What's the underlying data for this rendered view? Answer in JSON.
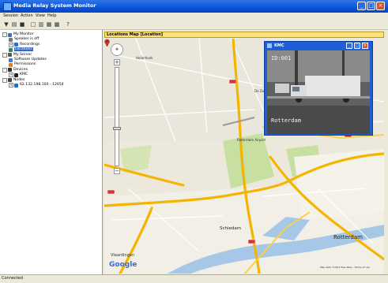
{
  "window": {
    "title": "Media Relay System Monitor"
  },
  "menu": [
    "Session",
    "Action",
    "View",
    "Help"
  ],
  "toolbar": [
    {
      "name": "filter-icon",
      "glyph": "▼"
    },
    {
      "name": "open-folder-icon",
      "glyph": "▤"
    },
    {
      "name": "save-icon",
      "glyph": "■"
    },
    {
      "name": "layout-single-icon",
      "glyph": "□"
    },
    {
      "name": "layout-split-icon",
      "glyph": "▥"
    },
    {
      "name": "layout-grid-icon",
      "glyph": "▦"
    },
    {
      "name": "layout-multi-icon",
      "glyph": "▩"
    },
    {
      "name": "help-icon",
      "glyph": "?"
    }
  ],
  "tree": [
    {
      "label": "My Monitor",
      "icon": "monitor-icon",
      "color": "#4a6fa5",
      "level": 0,
      "exp": "-"
    },
    {
      "label": "Speaker is off",
      "icon": "speaker-icon",
      "color": "#777777",
      "level": 1
    },
    {
      "label": "Recordings",
      "icon": "recordings-icon",
      "color": "#2f6fd0",
      "level": 1,
      "exp": "+"
    },
    {
      "label": "Locations",
      "icon": "globe-icon",
      "color": "#2e8b57",
      "level": 1,
      "selected": true
    },
    {
      "label": "My Server",
      "icon": "server-icon",
      "color": "#5a5a5a",
      "level": 0,
      "exp": "-"
    },
    {
      "label": "Software Updates",
      "icon": "updates-icon",
      "color": "#3a7bd5",
      "level": 1
    },
    {
      "label": "Permissions",
      "icon": "permissions-icon",
      "color": "#d9822b",
      "level": 1
    },
    {
      "label": "Devices",
      "icon": "devices-icon",
      "color": "#333333",
      "level": 0,
      "exp": "-"
    },
    {
      "label": "KMC",
      "icon": "camera-icon",
      "color": "#222222",
      "level": 1,
      "exp": "+"
    },
    {
      "label": "Nodes",
      "icon": "nodes-icon",
      "color": "#444444",
      "level": 0,
      "exp": "-"
    },
    {
      "label": "62.132.198.100 - 12654",
      "icon": "node-icon",
      "color": "#2b6cb0",
      "level": 1,
      "exp": "+"
    }
  ],
  "panel": {
    "header": "Locations Map [Location]"
  },
  "map": {
    "labels": [
      "Rotterdam",
      "Schiedam",
      "Vlaardingen",
      "De Zweth",
      "Rotterdam Airport"
    ],
    "google_logo": "Google",
    "copyright": "Map data ©2010 Tele Atlas - Terms of Use"
  },
  "camera": {
    "title": "KMC",
    "overlay_id": "ID:001",
    "overlay_location": "Rotterdam"
  },
  "status": {
    "text": "Connected"
  },
  "colors": {
    "titlebar": "#0a54d8",
    "selected": "#316ac5",
    "panel_header": "#ffe27a",
    "highway": "#f4b400",
    "water": "#a7c7e7",
    "park": "#c7dfa0"
  }
}
